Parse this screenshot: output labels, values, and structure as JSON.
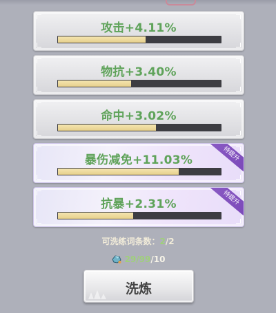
{
  "stats": [
    {
      "label": "攻击+4.11%",
      "fill": 0.54,
      "upgrade": false,
      "badge": ""
    },
    {
      "label": "物抗+3.40%",
      "fill": 0.45,
      "upgrade": false,
      "badge": ""
    },
    {
      "label": "命中+3.02%",
      "fill": 0.6,
      "upgrade": false,
      "badge": ""
    },
    {
      "label": "暴伤减免+11.03%",
      "fill": 0.74,
      "upgrade": true,
      "badge": "待提升"
    },
    {
      "label": "抗暴+2.31%",
      "fill": 0.46,
      "upgrade": true,
      "badge": "待提升"
    }
  ],
  "wash_count": {
    "label": "可洗练词条数：",
    "current": "2",
    "separator": "/",
    "max": "2"
  },
  "cost": {
    "icon": "material-gem-icon",
    "have": "29/99",
    "separator": "/",
    "need": "10"
  },
  "wash_button": {
    "label": "洗炼"
  },
  "colors": {
    "stat_text": "#5fa35a",
    "bar_fill": "#e7d08c",
    "ribbon": "#8a5bc4"
  }
}
